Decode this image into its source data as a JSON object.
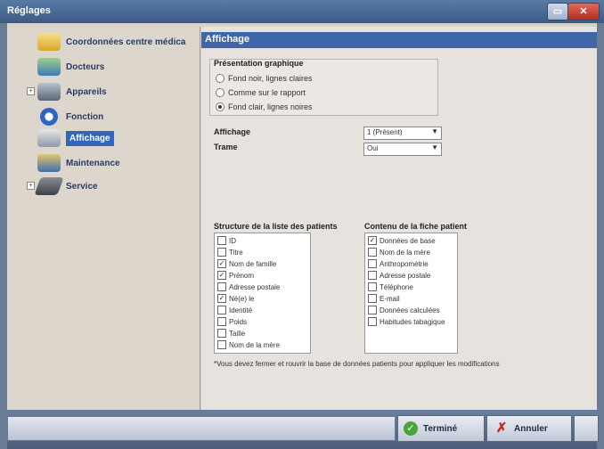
{
  "window": {
    "title": "Réglages",
    "minimize": "▭",
    "close": "✕"
  },
  "sidebar": {
    "items": [
      {
        "label": "Coordonnées centre médica",
        "icon": "folder-icon"
      },
      {
        "label": "Docteurs",
        "icon": "doctors-icon"
      },
      {
        "label": "Appareils",
        "icon": "devices-icon"
      },
      {
        "label": "Fonction",
        "icon": "function-icon"
      },
      {
        "label": "Affichage",
        "icon": "display-icon",
        "selected": true
      },
      {
        "label": "Maintenance",
        "icon": "maintenance-icon"
      },
      {
        "label": "Service",
        "icon": "service-icon"
      }
    ]
  },
  "panel": {
    "header": "Affichage",
    "graphics_group": {
      "title": "Présentation graphique",
      "options": [
        {
          "label": "Fond noir, lignes claires",
          "checked": false
        },
        {
          "label": "Comme sur le rapport",
          "checked": false
        },
        {
          "label": "Fond clair, lignes noires",
          "checked": true
        }
      ]
    },
    "display": {
      "label": "Affichage",
      "value": "1 (Présent)"
    },
    "trame": {
      "label": "Trame",
      "value": "Oui"
    },
    "patient_list": {
      "title": "Structure de la liste des patients",
      "items": [
        {
          "label": "ID",
          "checked": false
        },
        {
          "label": "Titre",
          "checked": false
        },
        {
          "label": "Nom de famille",
          "checked": true
        },
        {
          "label": "Prénom",
          "checked": true
        },
        {
          "label": "Adresse postale",
          "checked": false
        },
        {
          "label": "Né(e) le",
          "checked": true
        },
        {
          "label": "Identité",
          "checked": false
        },
        {
          "label": "Poids",
          "checked": false
        },
        {
          "label": "Taille",
          "checked": false
        },
        {
          "label": "Nom de la mère",
          "checked": false
        }
      ]
    },
    "patient_file": {
      "title": "Contenu de la fiche patient",
      "items": [
        {
          "label": "Données de base",
          "checked": true
        },
        {
          "label": "Nom de la mère",
          "checked": false
        },
        {
          "label": "Anthropométrie",
          "checked": false
        },
        {
          "label": "Adresse postale",
          "checked": false
        },
        {
          "label": "Téléphone",
          "checked": false
        },
        {
          "label": "E-mail",
          "checked": false
        },
        {
          "label": "Données calculées",
          "checked": false
        },
        {
          "label": "Habitudes tabagique",
          "checked": false
        }
      ]
    },
    "note": "*Vous devez fermer et rouvrir la base de données patients pour appliquer les modifications"
  },
  "footer": {
    "finish_label": "Terminé",
    "cancel_label": "Annuler"
  }
}
